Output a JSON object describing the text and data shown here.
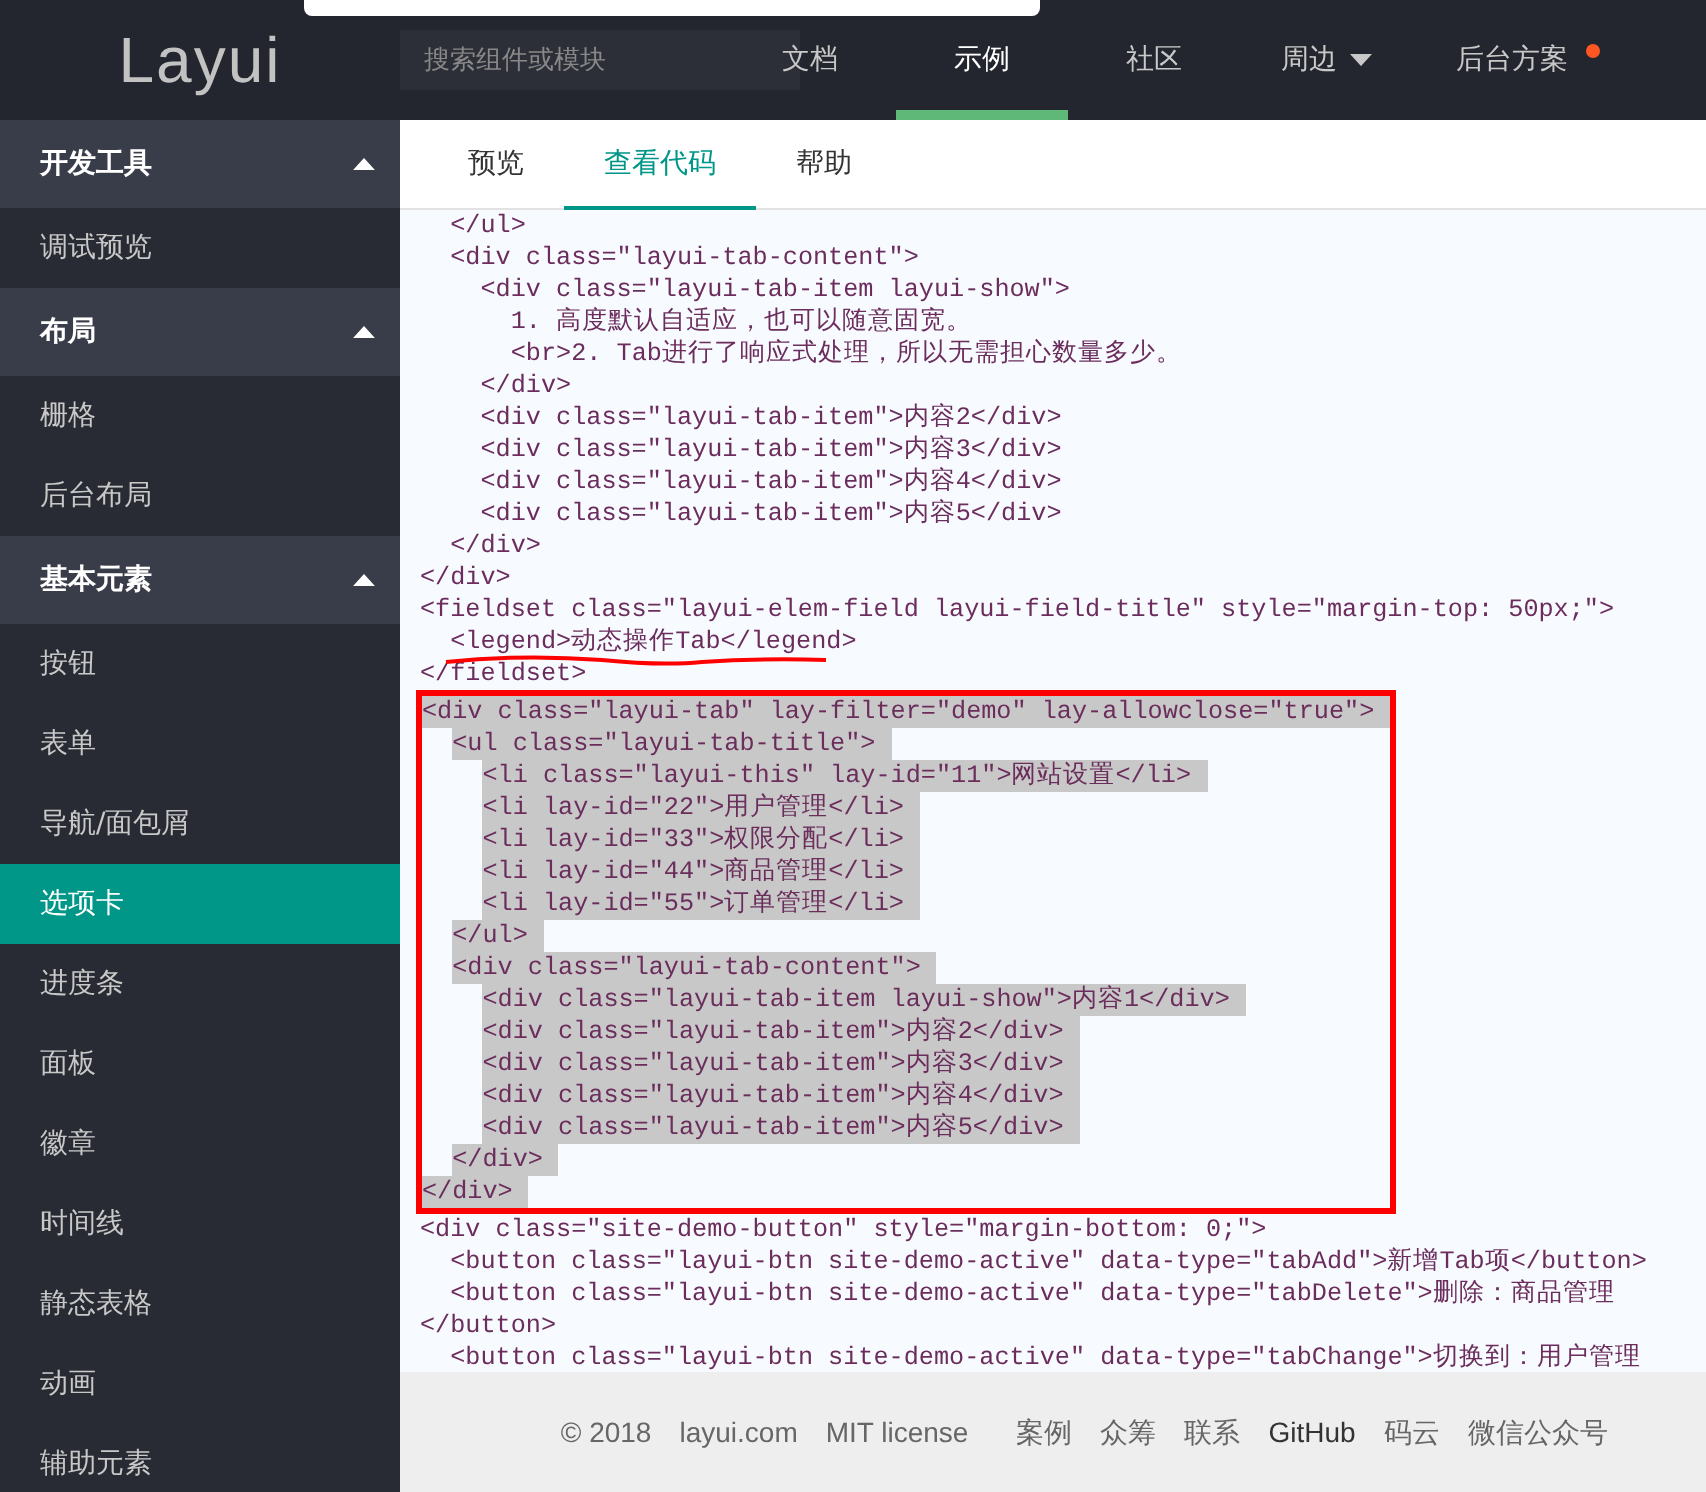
{
  "header": {
    "logo": "Layui",
    "search": {
      "placeholder": "搜索组件或模块"
    },
    "nav": [
      {
        "label": "文档",
        "selected": false
      },
      {
        "label": "示例",
        "selected": true
      },
      {
        "label": "社区",
        "selected": false
      },
      {
        "label": "周边",
        "selected": false,
        "caret": true
      },
      {
        "label": "后台方案",
        "selected": false,
        "dot": true
      }
    ]
  },
  "sidebar": {
    "items": [
      {
        "kind": "group",
        "label": "开发工具",
        "expanded": true
      },
      {
        "kind": "item",
        "label": "调试预览",
        "selected": false
      },
      {
        "kind": "group",
        "label": "布局",
        "expanded": true
      },
      {
        "kind": "item",
        "label": "栅格",
        "selected": false
      },
      {
        "kind": "item",
        "label": "后台布局",
        "selected": false
      },
      {
        "kind": "group",
        "label": "基本元素",
        "expanded": true
      },
      {
        "kind": "item",
        "label": "按钮",
        "selected": false
      },
      {
        "kind": "item",
        "label": "表单",
        "selected": false
      },
      {
        "kind": "item",
        "label": "导航/面包屑",
        "selected": false
      },
      {
        "kind": "item",
        "label": "选项卡",
        "selected": true
      },
      {
        "kind": "item",
        "label": "进度条",
        "selected": false
      },
      {
        "kind": "item",
        "label": "面板",
        "selected": false
      },
      {
        "kind": "item",
        "label": "徽章",
        "selected": false
      },
      {
        "kind": "item",
        "label": "时间线",
        "selected": false
      },
      {
        "kind": "item",
        "label": "静态表格",
        "selected": false
      },
      {
        "kind": "item",
        "label": "动画",
        "selected": false
      },
      {
        "kind": "item",
        "label": "辅助元素",
        "selected": false
      }
    ]
  },
  "tabs": [
    {
      "label": "预览",
      "selected": false
    },
    {
      "label": "查看代码",
      "selected": true
    },
    {
      "label": "帮助",
      "selected": false
    }
  ],
  "code_blocks": [
    {
      "boxed": false,
      "highlighted": false,
      "lines": [
        {
          "text": "  </ul>",
          "underlined": false
        },
        {
          "text": "  <div class=\"layui-tab-content\">",
          "underlined": false
        },
        {
          "text": "    <div class=\"layui-tab-item layui-show\">",
          "underlined": false
        },
        {
          "text": "      1. 高度默认自适应，也可以随意固宽。",
          "underlined": false
        },
        {
          "text": "      <br>2. Tab进行了响应式处理，所以无需担心数量多少。",
          "underlined": false
        },
        {
          "text": "    </div>",
          "underlined": false
        },
        {
          "text": "    <div class=\"layui-tab-item\">内容2</div>",
          "underlined": false
        },
        {
          "text": "    <div class=\"layui-tab-item\">内容3</div>",
          "underlined": false
        },
        {
          "text": "    <div class=\"layui-tab-item\">内容4</div>",
          "underlined": false
        },
        {
          "text": "    <div class=\"layui-tab-item\">内容5</div>",
          "underlined": false
        },
        {
          "text": "  </div>",
          "underlined": false
        },
        {
          "text": "</div>",
          "underlined": false
        },
        {
          "text": "<fieldset class=\"layui-elem-field layui-field-title\" style=\"margin-top: 50px;\">",
          "underlined": false
        },
        {
          "text": "  <legend>动态操作Tab</legend>",
          "underlined": true
        },
        {
          "text": "</fieldset>",
          "underlined": false
        }
      ]
    },
    {
      "boxed": true,
      "highlighted": true,
      "lines": [
        {
          "text": "<div class=\"layui-tab\" lay-filter=\"demo\" lay-allowclose=\"true\">",
          "underlined": false
        },
        {
          "text": "  <ul class=\"layui-tab-title\">",
          "underlined": false
        },
        {
          "text": "    <li class=\"layui-this\" lay-id=\"11\">网站设置</li>",
          "underlined": false
        },
        {
          "text": "    <li lay-id=\"22\">用户管理</li>",
          "underlined": false
        },
        {
          "text": "    <li lay-id=\"33\">权限分配</li>",
          "underlined": false
        },
        {
          "text": "    <li lay-id=\"44\">商品管理</li>",
          "underlined": false
        },
        {
          "text": "    <li lay-id=\"55\">订单管理</li>",
          "underlined": false
        },
        {
          "text": "  </ul>",
          "underlined": false
        },
        {
          "text": "  <div class=\"layui-tab-content\">",
          "underlined": false
        },
        {
          "text": "    <div class=\"layui-tab-item layui-show\">内容1</div>",
          "underlined": false
        },
        {
          "text": "    <div class=\"layui-tab-item\">内容2</div>",
          "underlined": false
        },
        {
          "text": "    <div class=\"layui-tab-item\">内容3</div>",
          "underlined": false
        },
        {
          "text": "    <div class=\"layui-tab-item\">内容4</div>",
          "underlined": false
        },
        {
          "text": "    <div class=\"layui-tab-item\">内容5</div>",
          "underlined": false
        },
        {
          "text": "  </div>",
          "underlined": false
        },
        {
          "text": "</div>",
          "underlined": false
        }
      ]
    },
    {
      "boxed": false,
      "highlighted": false,
      "lines": [
        {
          "text": "<div class=\"site-demo-button\" style=\"margin-bottom: 0;\">",
          "underlined": false
        },
        {
          "text": "  <button class=\"layui-btn site-demo-active\" data-type=\"tabAdd\">新增Tab项</button>",
          "underlined": false
        },
        {
          "text": "  <button class=\"layui-btn site-demo-active\" data-type=\"tabDelete\">删除：商品管理",
          "underlined": false
        },
        {
          "text": "</button>",
          "underlined": false
        },
        {
          "text": "  <button class=\"layui-btn site-demo-active\" data-type=\"tabChange\">切换到：用户管理",
          "underlined": false
        }
      ]
    }
  ],
  "footer": {
    "links": [
      {
        "kind": "text",
        "label": "© 2018"
      },
      {
        "kind": "link",
        "label": "layui.com"
      },
      {
        "kind": "link",
        "label": "MIT license"
      },
      {
        "kind": "link",
        "label": "案例"
      },
      {
        "kind": "link",
        "label": "众筹"
      },
      {
        "kind": "link",
        "label": "联系"
      },
      {
        "kind": "strong",
        "label": "GitHub"
      },
      {
        "kind": "link",
        "label": "码云"
      },
      {
        "kind": "link",
        "label": "微信公众号"
      }
    ]
  }
}
